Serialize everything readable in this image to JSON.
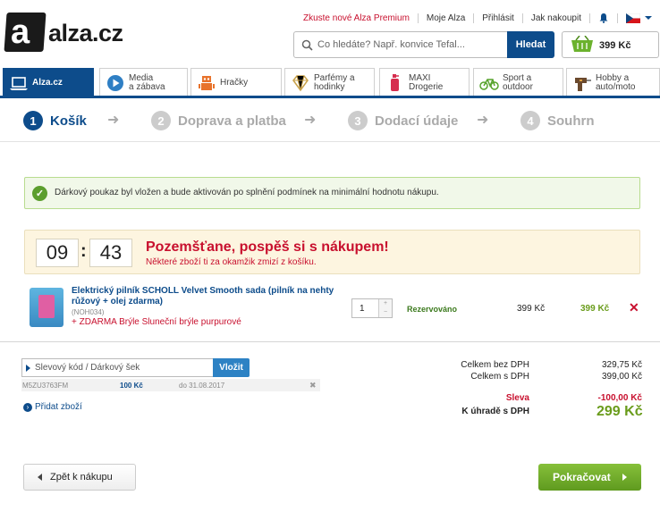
{
  "header": {
    "logo_letter": "a",
    "logo_text": "alza.cz",
    "links": [
      "Zkuste nové Alza Premium",
      "Moje Alza",
      "Přihlásit",
      "Jak nakoupit"
    ],
    "search_placeholder": "Co hledáte? Např. konvice Tefal...",
    "search_button": "Hledat",
    "cart_amount": "399 Kč"
  },
  "categories": [
    {
      "label": "Alza.cz",
      "icon": "laptop-icon"
    },
    {
      "label": "Media\na zábava",
      "icon": "play-icon"
    },
    {
      "label": "Hračky",
      "icon": "robot-icon"
    },
    {
      "label": "Parfémy a\nhodinky",
      "icon": "diamond-icon"
    },
    {
      "label": "MAXI\nDrogerie",
      "icon": "bottle-icon"
    },
    {
      "label": "Sport a\noutdoor",
      "icon": "bike-icon"
    },
    {
      "label": "Hobby a\nauto/moto",
      "icon": "drill-icon"
    }
  ],
  "steps": [
    {
      "num": "1",
      "label": "Košík"
    },
    {
      "num": "2",
      "label": "Doprava a platba"
    },
    {
      "num": "3",
      "label": "Dodací údaje"
    },
    {
      "num": "4",
      "label": "Souhrn"
    }
  ],
  "notice": "Dárkový poukaz byl vložen a bude aktivován po splnění podmínek na minimální hodnotu nákupu.",
  "timer": {
    "minutes": "09",
    "separator": ":",
    "seconds": "43",
    "title": "Pozemšťane, pospěš si s nákupem!",
    "subtitle": "Některé zboží ti za okamžik zmizí z košíku."
  },
  "item": {
    "name": "Elektrický pilník SCHOLL Velvet Smooth sada (pilník na nehty růžový + olej zdarma)",
    "code": "(NOH034)",
    "gift": "+ ZDARMA Brýle Sluneční brýle purpurové",
    "quantity": "1",
    "status": "Rezervováno",
    "unit_price": "399 Kč",
    "total_price": "399 Kč"
  },
  "voucher": {
    "placeholder": "Slevový kód / Dárkový šek",
    "button": "Vložit",
    "code": "M5ZU3763FM",
    "value": "100 Kč",
    "validity": "do 31.08.2017"
  },
  "add_goods": "Přidat zboží",
  "summary": {
    "without_vat_label": "Celkem bez DPH",
    "without_vat": "329,75 Kč",
    "with_vat_label": "Celkem s DPH",
    "with_vat": "399,00 Kč",
    "discount_label": "Sleva",
    "discount": "-100,00 Kč",
    "to_pay_label": "K úhradě s DPH",
    "to_pay": "299 Kč"
  },
  "buttons": {
    "back": "Zpět k nákupu",
    "continue": "Pokračovat"
  }
}
